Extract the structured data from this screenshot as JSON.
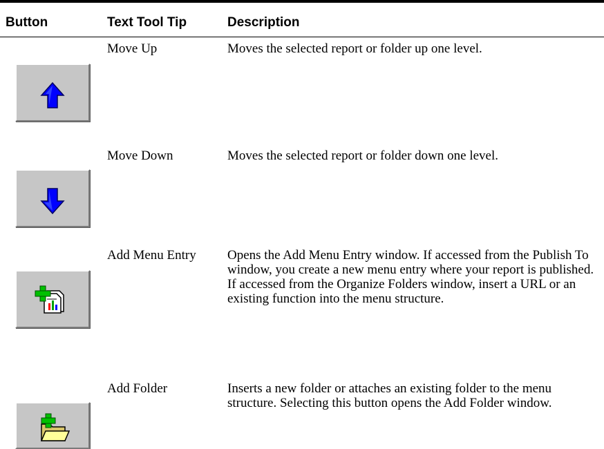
{
  "table": {
    "headers": {
      "button": "Button",
      "tooltip": "Text Tool Tip",
      "description": "Description"
    },
    "rows": [
      {
        "icon": "arrow-up-icon",
        "tooltip": "Move Up",
        "description": "Moves the selected report or folder up one level."
      },
      {
        "icon": "arrow-down-icon",
        "tooltip": "Move Down",
        "description": "Moves the selected report or folder down one level."
      },
      {
        "icon": "add-menu-entry-icon",
        "tooltip": "Add Menu Entry",
        "description": "Opens the Add Menu Entry window. If accessed from the Publish To window, you create a new menu entry where your report is published. If accessed from the Organize Folders window, insert a URL or an existing function into the menu structure."
      },
      {
        "icon": "add-folder-icon",
        "tooltip": "Add Folder",
        "description": "Inserts a new folder or attaches an existing folder to the menu structure. Selecting this button opens the Add Folder window."
      }
    ]
  },
  "colors": {
    "button_face": "#c6c6c6",
    "arrow_blue": "#0000ff",
    "plus_green": "#00c000",
    "folder_yellow": "#ffff99"
  }
}
